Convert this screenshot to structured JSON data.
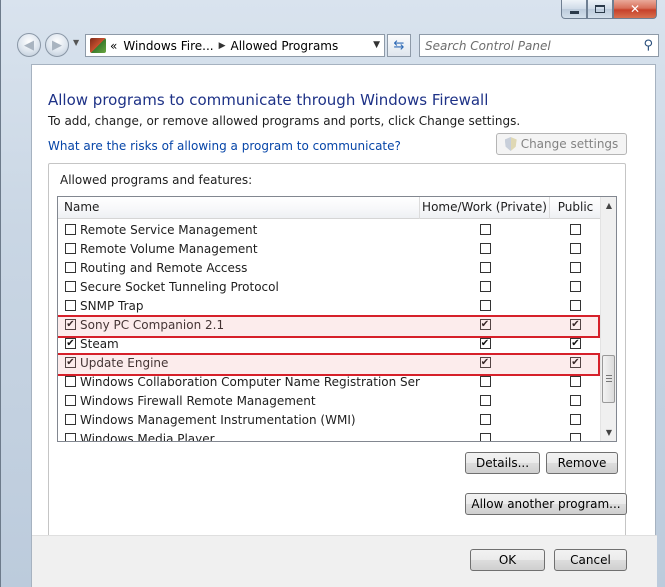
{
  "window": {
    "minimize_icon": "minimize-icon",
    "maximize_icon": "maximize-icon",
    "close_icon": "close-icon",
    "close_label": "✕"
  },
  "nav": {
    "back_glyph": "◀",
    "forward_glyph": "▶",
    "breadcrumb": {
      "prefix": "«",
      "items": [
        "Windows Fire...",
        "Allowed Programs"
      ],
      "separator": "▶"
    },
    "refresh_glyph": "⇆",
    "search_placeholder": "Search Control Panel"
  },
  "page": {
    "title": "Allow programs to communicate through Windows Firewall",
    "instructions": "To add, change, or remove allowed programs and ports, click Change settings.",
    "risks_link": "What are the risks of allowing a program to communicate?",
    "change_settings_label": "Change settings",
    "group_label": "Allowed programs and features:",
    "columns": {
      "name": "Name",
      "home": "Home/Work (Private)",
      "public": "Public"
    },
    "rows": [
      {
        "name": "Remote Service Management",
        "enabled": false,
        "home": false,
        "public": false,
        "highlighted": false
      },
      {
        "name": "Remote Volume Management",
        "enabled": false,
        "home": false,
        "public": false,
        "highlighted": false
      },
      {
        "name": "Routing and Remote Access",
        "enabled": false,
        "home": false,
        "public": false,
        "highlighted": false
      },
      {
        "name": "Secure Socket Tunneling Protocol",
        "enabled": false,
        "home": false,
        "public": false,
        "highlighted": false
      },
      {
        "name": "SNMP Trap",
        "enabled": false,
        "home": false,
        "public": false,
        "highlighted": false
      },
      {
        "name": "Sony PC Companion 2.1",
        "enabled": true,
        "home": true,
        "public": true,
        "highlighted": true
      },
      {
        "name": "Steam",
        "enabled": true,
        "home": true,
        "public": true,
        "highlighted": false
      },
      {
        "name": "Update Engine",
        "enabled": true,
        "home": true,
        "public": true,
        "highlighted": true
      },
      {
        "name": "Windows Collaboration Computer Name Registration Service",
        "enabled": false,
        "home": false,
        "public": false,
        "highlighted": false
      },
      {
        "name": "Windows Firewall Remote Management",
        "enabled": false,
        "home": false,
        "public": false,
        "highlighted": false
      },
      {
        "name": "Windows Management Instrumentation (WMI)",
        "enabled": false,
        "home": false,
        "public": false,
        "highlighted": false
      },
      {
        "name": "Windows Media Player",
        "enabled": false,
        "home": false,
        "public": false,
        "highlighted": false
      }
    ],
    "details_label": "Details...",
    "remove_label": "Remove",
    "allow_another_label": "Allow another program...",
    "ok_label": "OK",
    "cancel_label": "Cancel"
  },
  "colors": {
    "title_blue": "#1e3287",
    "link_blue": "#0645a8",
    "highlight_red": "#d6202a"
  }
}
